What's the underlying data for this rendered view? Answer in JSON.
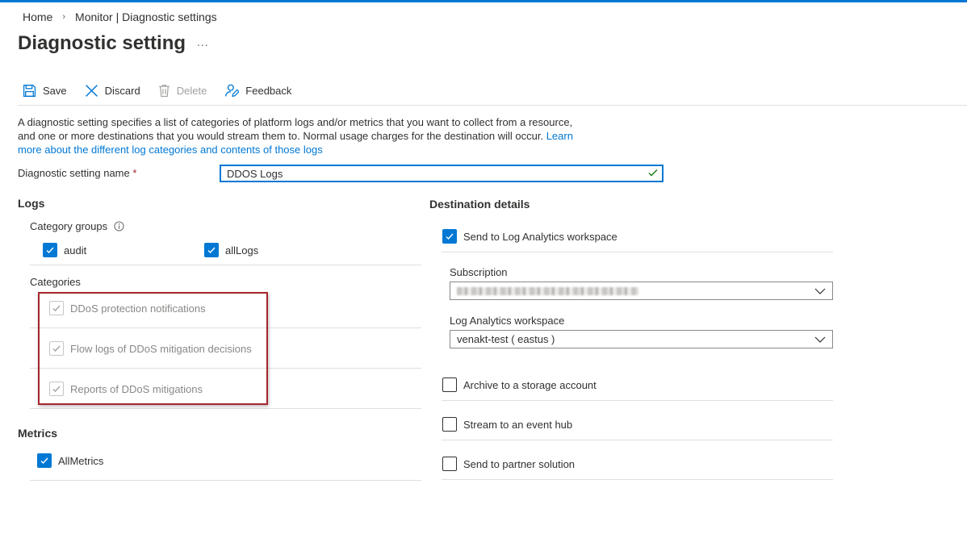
{
  "breadcrumb": {
    "home": "Home",
    "current": "Monitor | Diagnostic settings"
  },
  "page": {
    "title": "Diagnostic setting",
    "more": "..."
  },
  "toolbar": {
    "save": "Save",
    "discard": "Discard",
    "delete": "Delete",
    "feedback": "Feedback"
  },
  "description": {
    "text": "A diagnostic setting specifies a list of categories of platform logs and/or metrics that you want to collect from a resource, and one or more destinations that you would stream them to. Normal usage charges for the destination will occur.",
    "link": "Learn more about the different log categories and contents of those logs"
  },
  "name_field": {
    "label": "Diagnostic setting name",
    "required": "*",
    "value": "DDOS Logs"
  },
  "logs": {
    "heading": "Logs",
    "category_groups_label": "Category groups",
    "groups": [
      {
        "label": "audit",
        "checked": true
      },
      {
        "label": "allLogs",
        "checked": true
      }
    ],
    "categories_label": "Categories",
    "categories": [
      {
        "label": "DDoS protection notifications",
        "checked": true,
        "disabled": true
      },
      {
        "label": "Flow logs of DDoS mitigation decisions",
        "checked": true,
        "disabled": true
      },
      {
        "label": "Reports of DDoS mitigations",
        "checked": true,
        "disabled": true
      }
    ]
  },
  "metrics": {
    "heading": "Metrics",
    "items": [
      {
        "label": "AllMetrics",
        "checked": true
      }
    ]
  },
  "destination": {
    "heading": "Destination details",
    "log_analytics": {
      "label": "Send to Log Analytics workspace",
      "checked": true
    },
    "subscription_label": "Subscription",
    "workspace_label": "Log Analytics workspace",
    "workspace_value": "venakt-test ( eastus )",
    "archive": {
      "label": "Archive to a storage account",
      "checked": false
    },
    "event_hub": {
      "label": "Stream to an event hub",
      "checked": false
    },
    "partner": {
      "label": "Send to partner solution",
      "checked": false
    }
  },
  "colors": {
    "accent": "#0078d4",
    "highlight_border": "#a4262c",
    "divider": "#e1dfdd"
  }
}
